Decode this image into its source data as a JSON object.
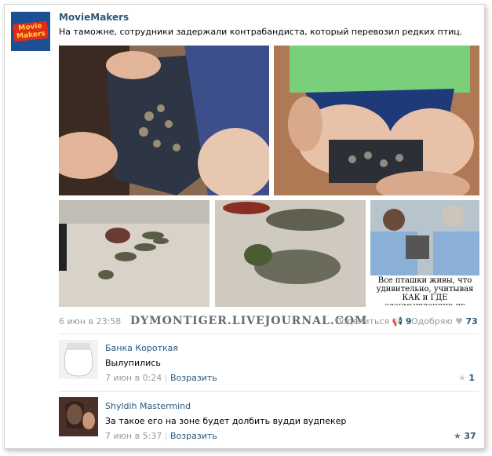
{
  "post": {
    "author": "MovieMakers",
    "avatar_logo": "Movie Makers",
    "text": "На таможне, сотрудники задержали контрабандиста, который перевозил редких птиц.",
    "timestamp": "6 июн в 23:58",
    "watermark": "DYMONTIGER.LIVEJOURNAL.COM",
    "share_label": "Поделиться",
    "share_count": "9",
    "like_label": "Одобряю",
    "like_count": "73",
    "caption": "Все пташки живы, что удивительно, учитывая КАК и ГДЕ злоумышленник их перевозил"
  },
  "comments": [
    {
      "name": "Банка Короткая",
      "text": "Вылупились",
      "time": "7 июн в 0:24",
      "reply": "Возразить",
      "likes": "1"
    },
    {
      "name": "Shyldih Mastermind",
      "text": "За такое его на зоне будет долбить вудди вудпекер",
      "time": "7 июн в 5:37",
      "reply": "Возразить",
      "likes": "37"
    }
  ],
  "colors": {
    "link": "#2b587a",
    "muted": "#999999",
    "divider": "#e7e8ec"
  },
  "icons": [
    "share-icon",
    "heart-icon",
    "star-icon"
  ]
}
